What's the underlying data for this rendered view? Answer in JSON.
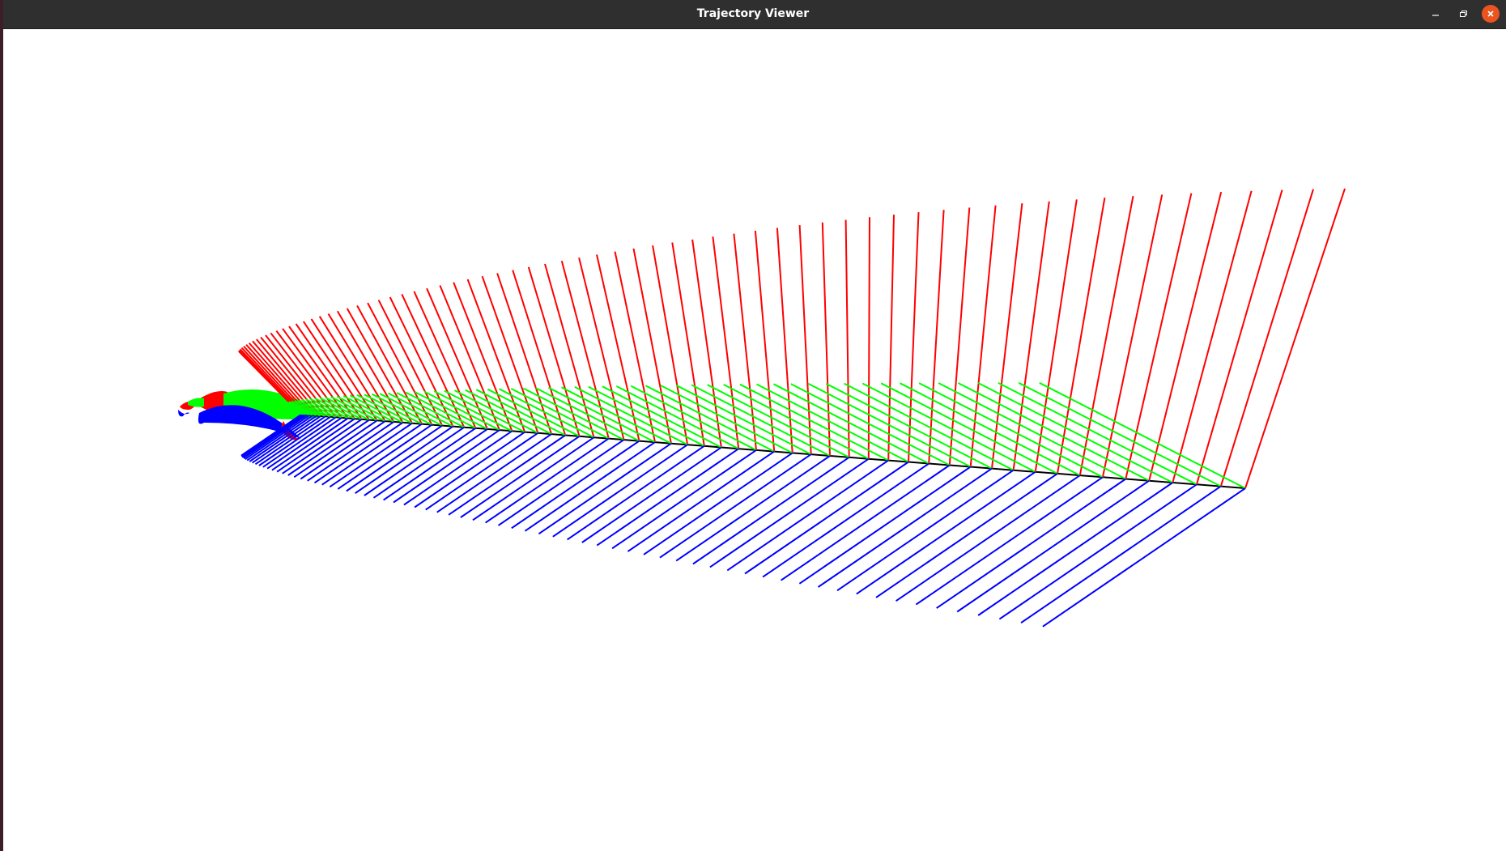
{
  "window": {
    "title": "Trajectory Viewer",
    "controls": {
      "minimize_icon": "minimize-icon",
      "maximize_icon": "restore-icon",
      "close_icon": "close-icon"
    },
    "close_color": "#e95420",
    "titlebar_color": "#2f2f2f"
  },
  "viewer": {
    "background": "#ffffff",
    "axis_colors": {
      "x": "#ff0000",
      "y": "#00ff00",
      "z": "#0000ff",
      "path": "#000000"
    }
  }
}
